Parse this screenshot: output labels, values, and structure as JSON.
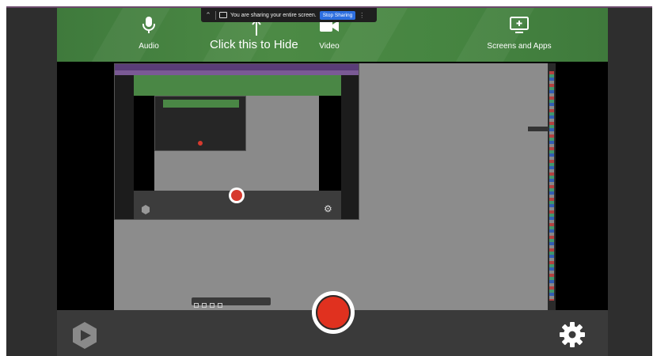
{
  "sources": {
    "audio": {
      "label": "Audio",
      "icon": "microphone-icon"
    },
    "video": {
      "label": "Video",
      "icon": "camera-icon"
    },
    "screens": {
      "label": "Screens and Apps",
      "icon": "monitor-plus-icon"
    }
  },
  "hint": {
    "text": "Click this to Hide",
    "icon": "arrow-up-icon"
  },
  "share_banner": {
    "message": "You are sharing your entire screen.",
    "stop_label": "Stop Sharing",
    "hide_icon": "hide-icon",
    "share_icon": "share-screen-icon",
    "more_icon": "more-icon"
  },
  "controls": {
    "logo_icon": "app-logo-icon",
    "record_icon": "record-icon",
    "settings_icon": "gear-icon"
  },
  "colors": {
    "green": "#468541",
    "record_red": "#e0311f",
    "stop_blue": "#2d6fe0",
    "dark": "#2b2b2b"
  }
}
